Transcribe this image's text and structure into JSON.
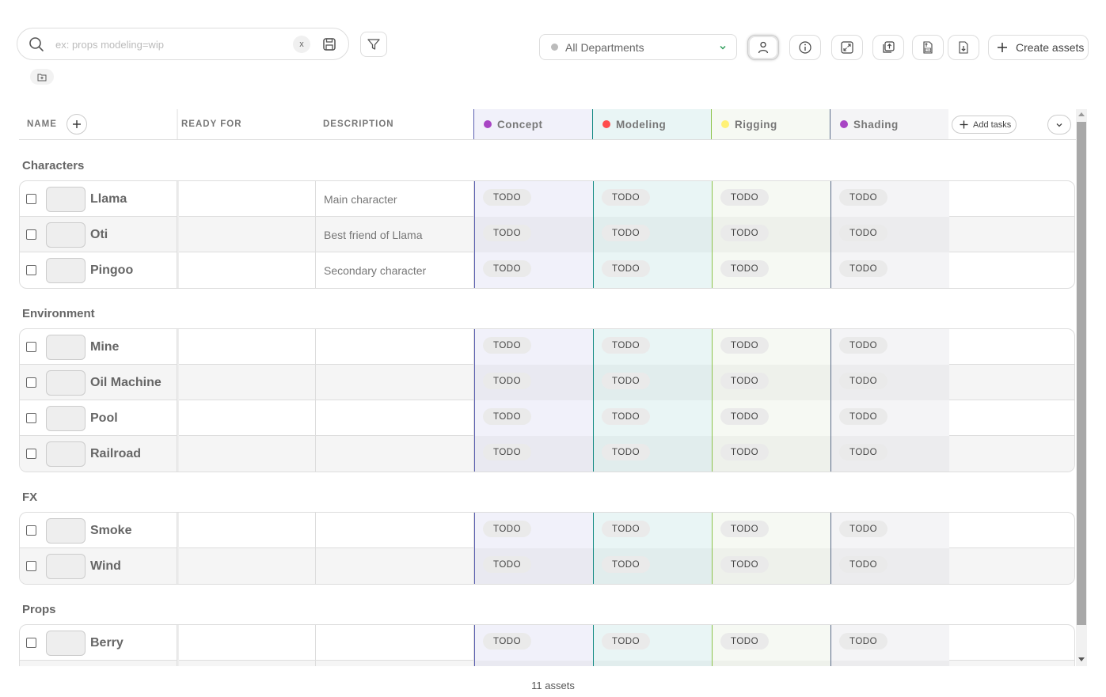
{
  "search": {
    "placeholder": "ex: props modeling=wip",
    "value": "",
    "clear_label": "x"
  },
  "toolbar": {
    "department": {
      "selected": "All Departments",
      "dot_color": "#bbbbbb"
    },
    "icons": [
      "person-icon",
      "info-icon",
      "expand-icon",
      "import-icon",
      "csv-import-icon",
      "export-icon"
    ],
    "create_label": "Create assets"
  },
  "table": {
    "headers": {
      "name": "NAME",
      "ready_for": "READY FOR",
      "description": "DESCRIPTION",
      "add_tasks": "Add tasks"
    },
    "task_columns": [
      {
        "label": "Concept",
        "color": "#a845c4",
        "bg": "#f1f1fa",
        "bg_alt": "#e9e9f1",
        "border": "#5a5fb0"
      },
      {
        "label": "Modeling",
        "color": "#ff4d4d",
        "bg": "#e9f5f5",
        "bg_alt": "#e1eded",
        "border": "#138a83"
      },
      {
        "label": "Rigging",
        "color": "#fff176",
        "bg": "#f6f9f3",
        "bg_alt": "#eef1eb",
        "border": "#8bc34a"
      },
      {
        "label": "Shading",
        "color": "#a845c4",
        "bg": "#f4f4f6",
        "bg_alt": "#ececee",
        "border": "#5a6b8a"
      }
    ],
    "groups": [
      {
        "title": "Characters",
        "rows": [
          {
            "name": "Llama",
            "ready_for": "",
            "description": "Main character",
            "tasks": [
              "TODO",
              "TODO",
              "TODO",
              "TODO"
            ]
          },
          {
            "name": "Oti",
            "ready_for": "",
            "description": "Best friend of Llama",
            "tasks": [
              "TODO",
              "TODO",
              "TODO",
              "TODO"
            ]
          },
          {
            "name": "Pingoo",
            "ready_for": "",
            "description": "Secondary character",
            "tasks": [
              "TODO",
              "TODO",
              "TODO",
              "TODO"
            ]
          }
        ]
      },
      {
        "title": "Environment",
        "rows": [
          {
            "name": "Mine",
            "ready_for": "",
            "description": "",
            "tasks": [
              "TODO",
              "TODO",
              "TODO",
              "TODO"
            ]
          },
          {
            "name": "Oil Machine",
            "ready_for": "",
            "description": "",
            "tasks": [
              "TODO",
              "TODO",
              "TODO",
              "TODO"
            ]
          },
          {
            "name": "Pool",
            "ready_for": "",
            "description": "",
            "tasks": [
              "TODO",
              "TODO",
              "TODO",
              "TODO"
            ]
          },
          {
            "name": "Railroad",
            "ready_for": "",
            "description": "",
            "tasks": [
              "TODO",
              "TODO",
              "TODO",
              "TODO"
            ]
          }
        ]
      },
      {
        "title": "FX",
        "rows": [
          {
            "name": "Smoke",
            "ready_for": "",
            "description": "",
            "tasks": [
              "TODO",
              "TODO",
              "TODO",
              "TODO"
            ]
          },
          {
            "name": "Wind",
            "ready_for": "",
            "description": "",
            "tasks": [
              "TODO",
              "TODO",
              "TODO",
              "TODO"
            ]
          }
        ]
      },
      {
        "title": "Props",
        "rows": [
          {
            "name": "Berry",
            "ready_for": "",
            "description": "",
            "tasks": [
              "TODO",
              "TODO",
              "TODO",
              "TODO"
            ]
          },
          {
            "name": "",
            "ready_for": "",
            "description": "",
            "tasks": [
              "",
              "",
              "",
              ""
            ]
          }
        ]
      }
    ]
  },
  "footer": {
    "count_label": "11 assets"
  }
}
